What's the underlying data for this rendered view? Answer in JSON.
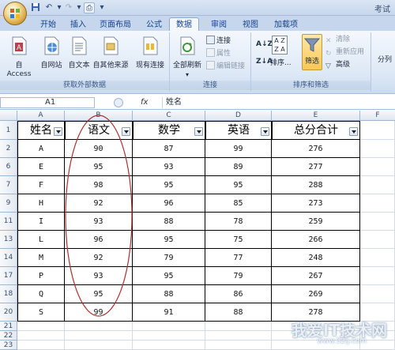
{
  "window": {
    "title": "考试"
  },
  "quick_access": [
    "save",
    "undo",
    "redo",
    "customize"
  ],
  "tabs": [
    {
      "label": "开始"
    },
    {
      "label": "插入"
    },
    {
      "label": "页面布局"
    },
    {
      "label": "公式"
    },
    {
      "label": "数据",
      "active": true
    },
    {
      "label": "审阅"
    },
    {
      "label": "视图"
    },
    {
      "label": "加载项"
    }
  ],
  "ribbon": {
    "external": {
      "label": "获取外部数据",
      "buttons": [
        "自 Access",
        "自网站",
        "自文本",
        "自其他来源",
        "现有连接"
      ]
    },
    "connections": {
      "label": "连接",
      "refresh": "全部刷新",
      "small": [
        "连接",
        "属性",
        "编辑链接"
      ]
    },
    "sort_filter": {
      "label": "排序和筛选",
      "sort": "排序...",
      "filter": "筛选",
      "small": [
        "清除",
        "重新应用",
        "高级"
      ]
    },
    "outline": {
      "label": "分列"
    }
  },
  "formula_bar": {
    "cell": "A1",
    "fx": "fx",
    "content": "姓名"
  },
  "columns": [
    "A",
    "B",
    "C",
    "D",
    "E",
    "F"
  ],
  "row_numbers": [
    "1",
    "2",
    "6",
    "7",
    "9",
    "11",
    "13",
    "14",
    "17",
    "18",
    "20",
    "21",
    "22",
    "23"
  ],
  "headers": [
    "姓名",
    "语文",
    "数学",
    "英语",
    "总分合计"
  ],
  "rows": [
    [
      "A",
      "90",
      "87",
      "99",
      "276"
    ],
    [
      "E",
      "95",
      "93",
      "89",
      "277"
    ],
    [
      "F",
      "98",
      "95",
      "95",
      "288"
    ],
    [
      "H",
      "92",
      "96",
      "85",
      "273"
    ],
    [
      "I",
      "93",
      "88",
      "78",
      "259"
    ],
    [
      "L",
      "96",
      "95",
      "75",
      "266"
    ],
    [
      "M",
      "92",
      "79",
      "77",
      "248"
    ],
    [
      "P",
      "93",
      "95",
      "79",
      "267"
    ],
    [
      "Q",
      "95",
      "88",
      "86",
      "269"
    ],
    [
      "S",
      "99",
      "91",
      "88",
      "278"
    ]
  ],
  "watermark": {
    "text": "我爱IT技术网",
    "url": "www.52ij.com"
  },
  "colors": {
    "ribbon": "#dde8f6",
    "filter_active": "#f9c756",
    "annotation": "#b03030"
  }
}
